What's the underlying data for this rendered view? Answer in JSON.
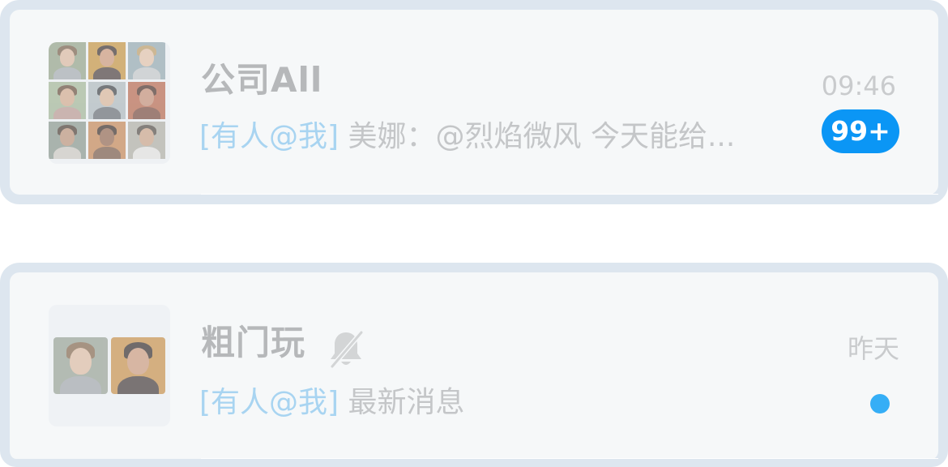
{
  "conversations": [
    {
      "title": "公司All",
      "time": "09:46",
      "mention_tag": "[有人@我]",
      "message": " 美娜：@烈焰微风 今天能给...",
      "unread_badge": "99+",
      "avatar_icon": "group-avatar-grid",
      "avatar_count": 9
    },
    {
      "title": "粗门玩",
      "time": "昨天",
      "mention_tag": "[有人@我]",
      "message": " 最新消息",
      "muted_icon": "bell-off-icon",
      "avatar_icon": "group-avatar-duo",
      "unread_indicator": "dot"
    }
  ],
  "colors": {
    "badge": "#0b96f5",
    "unread_dot": "#35aef6",
    "mention": "#a8d4f1",
    "card_border": "#dde6ef"
  }
}
